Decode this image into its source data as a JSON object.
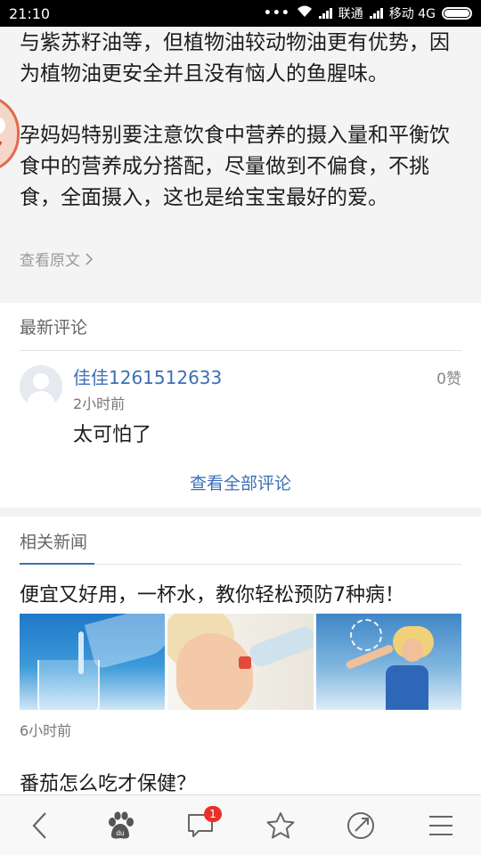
{
  "status_bar": {
    "time": "21:10",
    "carrier1": "联通",
    "carrier2": "移动 4G"
  },
  "article": {
    "paragraph1": "与紫苏籽油等，但植物油较动物油更有优势，因为植物油更安全并且没有恼人的鱼腥味。",
    "paragraph2": "孕妈妈特别要注意饮食中营养的摄入量和平衡饮食中的营养成分搭配，尽量做到不偏食，不挑食，全面摄入，这也是给宝宝最好的爱。",
    "view_original": "查看原文"
  },
  "comments": {
    "section_title": "最新评论",
    "items": [
      {
        "username": "佳佳1261512633",
        "time": "2小时前",
        "text": "太可怕了",
        "likes": "0赞"
      }
    ],
    "view_all": "查看全部评论"
  },
  "related": {
    "section_title": "相关新闻",
    "items": [
      {
        "title": "便宜又好用，一杯水，教你轻松预防7种病！",
        "time": "6小时前"
      },
      {
        "title": "番茄怎么吃才保健？"
      }
    ]
  },
  "bottom_bar": {
    "comment_badge": "1",
    "icons": [
      "back-icon",
      "baidu-paw-icon",
      "comment-icon",
      "star-icon",
      "share-icon",
      "menu-icon"
    ]
  },
  "colors": {
    "accent_blue": "#3b6fb6",
    "badge_red": "#e8312a",
    "article_bg": "#f4f4f5"
  }
}
